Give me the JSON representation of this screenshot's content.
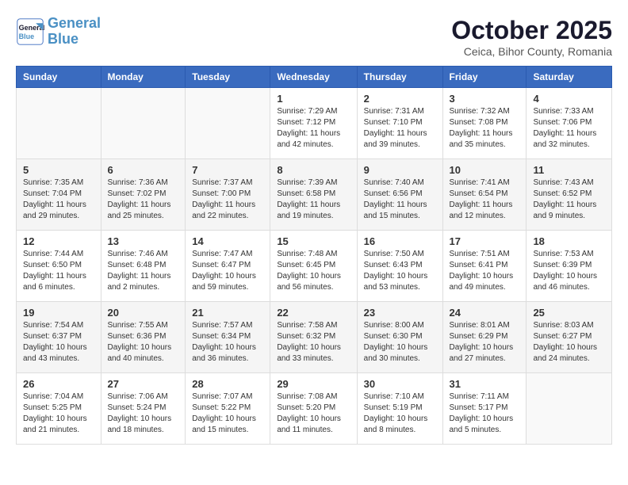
{
  "header": {
    "logo_line1": "General",
    "logo_line2": "Blue",
    "month": "October 2025",
    "location": "Ceica, Bihor County, Romania"
  },
  "weekdays": [
    "Sunday",
    "Monday",
    "Tuesday",
    "Wednesday",
    "Thursday",
    "Friday",
    "Saturday"
  ],
  "weeks": [
    [
      {
        "num": "",
        "info": ""
      },
      {
        "num": "",
        "info": ""
      },
      {
        "num": "",
        "info": ""
      },
      {
        "num": "1",
        "info": "Sunrise: 7:29 AM\nSunset: 7:12 PM\nDaylight: 11 hours\nand 42 minutes."
      },
      {
        "num": "2",
        "info": "Sunrise: 7:31 AM\nSunset: 7:10 PM\nDaylight: 11 hours\nand 39 minutes."
      },
      {
        "num": "3",
        "info": "Sunrise: 7:32 AM\nSunset: 7:08 PM\nDaylight: 11 hours\nand 35 minutes."
      },
      {
        "num": "4",
        "info": "Sunrise: 7:33 AM\nSunset: 7:06 PM\nDaylight: 11 hours\nand 32 minutes."
      }
    ],
    [
      {
        "num": "5",
        "info": "Sunrise: 7:35 AM\nSunset: 7:04 PM\nDaylight: 11 hours\nand 29 minutes."
      },
      {
        "num": "6",
        "info": "Sunrise: 7:36 AM\nSunset: 7:02 PM\nDaylight: 11 hours\nand 25 minutes."
      },
      {
        "num": "7",
        "info": "Sunrise: 7:37 AM\nSunset: 7:00 PM\nDaylight: 11 hours\nand 22 minutes."
      },
      {
        "num": "8",
        "info": "Sunrise: 7:39 AM\nSunset: 6:58 PM\nDaylight: 11 hours\nand 19 minutes."
      },
      {
        "num": "9",
        "info": "Sunrise: 7:40 AM\nSunset: 6:56 PM\nDaylight: 11 hours\nand 15 minutes."
      },
      {
        "num": "10",
        "info": "Sunrise: 7:41 AM\nSunset: 6:54 PM\nDaylight: 11 hours\nand 12 minutes."
      },
      {
        "num": "11",
        "info": "Sunrise: 7:43 AM\nSunset: 6:52 PM\nDaylight: 11 hours\nand 9 minutes."
      }
    ],
    [
      {
        "num": "12",
        "info": "Sunrise: 7:44 AM\nSunset: 6:50 PM\nDaylight: 11 hours\nand 6 minutes."
      },
      {
        "num": "13",
        "info": "Sunrise: 7:46 AM\nSunset: 6:48 PM\nDaylight: 11 hours\nand 2 minutes."
      },
      {
        "num": "14",
        "info": "Sunrise: 7:47 AM\nSunset: 6:47 PM\nDaylight: 10 hours\nand 59 minutes."
      },
      {
        "num": "15",
        "info": "Sunrise: 7:48 AM\nSunset: 6:45 PM\nDaylight: 10 hours\nand 56 minutes."
      },
      {
        "num": "16",
        "info": "Sunrise: 7:50 AM\nSunset: 6:43 PM\nDaylight: 10 hours\nand 53 minutes."
      },
      {
        "num": "17",
        "info": "Sunrise: 7:51 AM\nSunset: 6:41 PM\nDaylight: 10 hours\nand 49 minutes."
      },
      {
        "num": "18",
        "info": "Sunrise: 7:53 AM\nSunset: 6:39 PM\nDaylight: 10 hours\nand 46 minutes."
      }
    ],
    [
      {
        "num": "19",
        "info": "Sunrise: 7:54 AM\nSunset: 6:37 PM\nDaylight: 10 hours\nand 43 minutes."
      },
      {
        "num": "20",
        "info": "Sunrise: 7:55 AM\nSunset: 6:36 PM\nDaylight: 10 hours\nand 40 minutes."
      },
      {
        "num": "21",
        "info": "Sunrise: 7:57 AM\nSunset: 6:34 PM\nDaylight: 10 hours\nand 36 minutes."
      },
      {
        "num": "22",
        "info": "Sunrise: 7:58 AM\nSunset: 6:32 PM\nDaylight: 10 hours\nand 33 minutes."
      },
      {
        "num": "23",
        "info": "Sunrise: 8:00 AM\nSunset: 6:30 PM\nDaylight: 10 hours\nand 30 minutes."
      },
      {
        "num": "24",
        "info": "Sunrise: 8:01 AM\nSunset: 6:29 PM\nDaylight: 10 hours\nand 27 minutes."
      },
      {
        "num": "25",
        "info": "Sunrise: 8:03 AM\nSunset: 6:27 PM\nDaylight: 10 hours\nand 24 minutes."
      }
    ],
    [
      {
        "num": "26",
        "info": "Sunrise: 7:04 AM\nSunset: 5:25 PM\nDaylight: 10 hours\nand 21 minutes."
      },
      {
        "num": "27",
        "info": "Sunrise: 7:06 AM\nSunset: 5:24 PM\nDaylight: 10 hours\nand 18 minutes."
      },
      {
        "num": "28",
        "info": "Sunrise: 7:07 AM\nSunset: 5:22 PM\nDaylight: 10 hours\nand 15 minutes."
      },
      {
        "num": "29",
        "info": "Sunrise: 7:08 AM\nSunset: 5:20 PM\nDaylight: 10 hours\nand 11 minutes."
      },
      {
        "num": "30",
        "info": "Sunrise: 7:10 AM\nSunset: 5:19 PM\nDaylight: 10 hours\nand 8 minutes."
      },
      {
        "num": "31",
        "info": "Sunrise: 7:11 AM\nSunset: 5:17 PM\nDaylight: 10 hours\nand 5 minutes."
      },
      {
        "num": "",
        "info": ""
      }
    ]
  ]
}
